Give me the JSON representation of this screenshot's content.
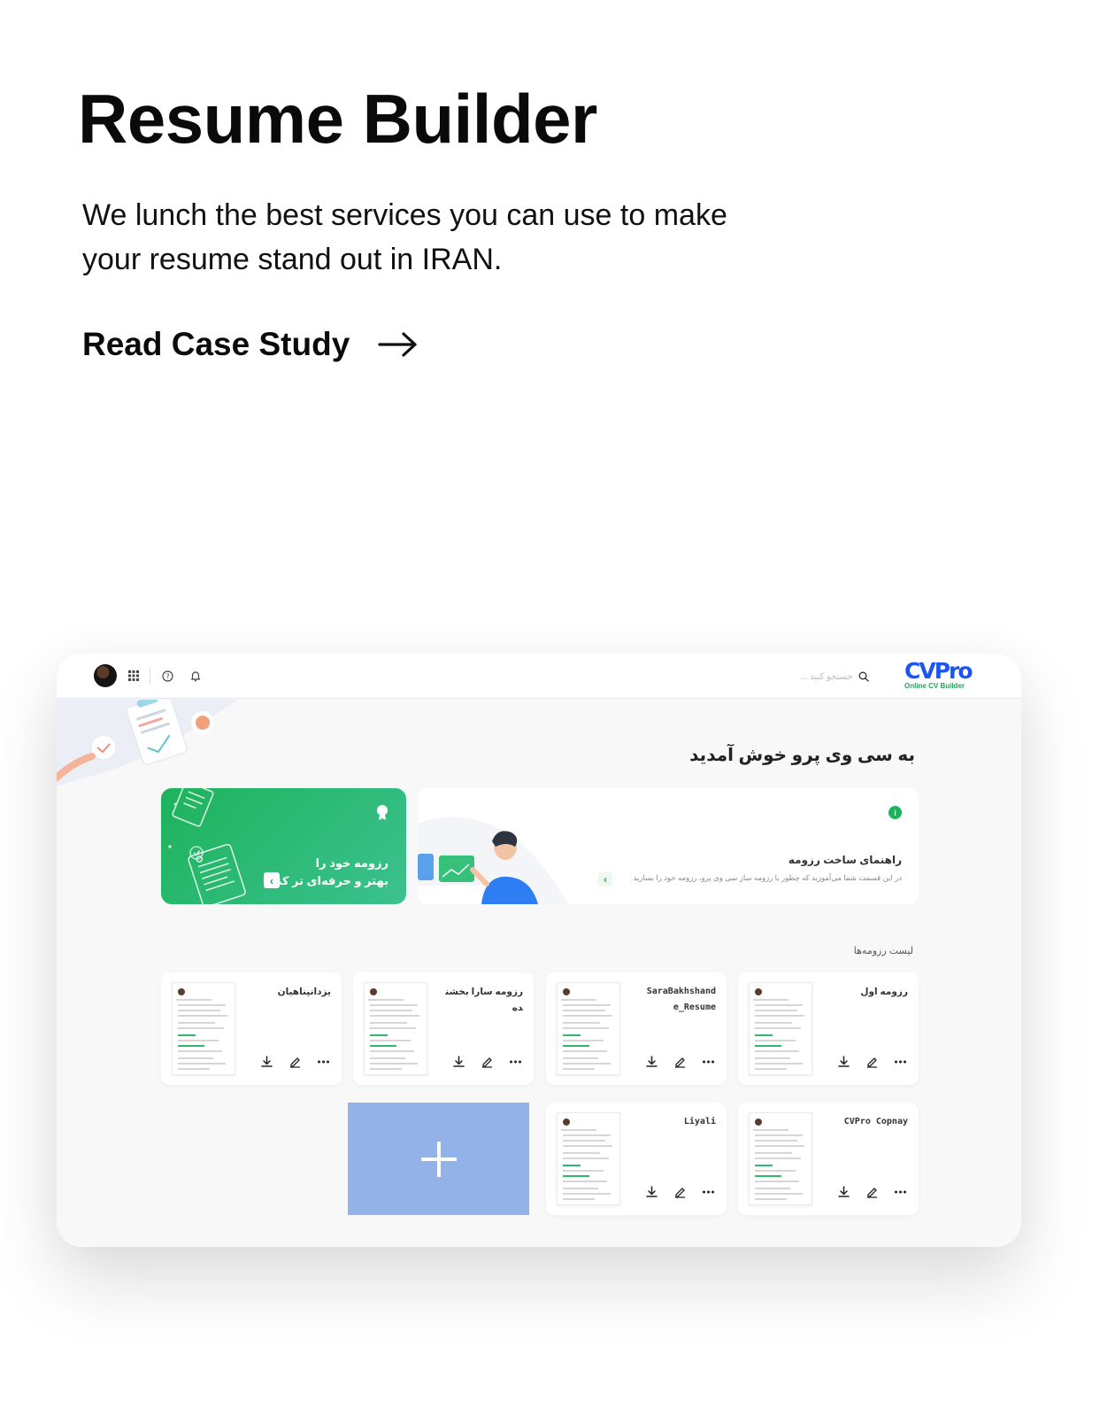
{
  "hero": {
    "title": "Resume Builder",
    "description": "We lunch the best services you can use to make your resume stand out in IRAN.",
    "cta_label": "Read Case Study"
  },
  "app": {
    "logo_main": "CVPro",
    "logo_sub": "Online CV Builder",
    "search_placeholder": "جستجو کنید ...",
    "welcome": "به سی وی پرو خوش آمدید",
    "promo_line1": "رزومه خود را",
    "promo_line2": "بهتر و حرفه‌ای تر کنید",
    "guide_title": "راهنمای ساخت رزومه",
    "guide_desc": "در این قسمت شما می‌آموزید که چطور با رزومه ساز سی وی پرو، رزومه خود را بسازید",
    "list_label": "لیست رزومه‌ها",
    "resumes": [
      "رزومه اول",
      "SaraBakhshand e_Resume",
      "رزومه سارا بخشنده",
      "یزدانپناهیان",
      "CVPro Copnay",
      "Liyali"
    ]
  },
  "colors": {
    "brand_blue": "#1c55f0",
    "brand_green": "#1db35b",
    "add_card": "#92b2e8"
  }
}
